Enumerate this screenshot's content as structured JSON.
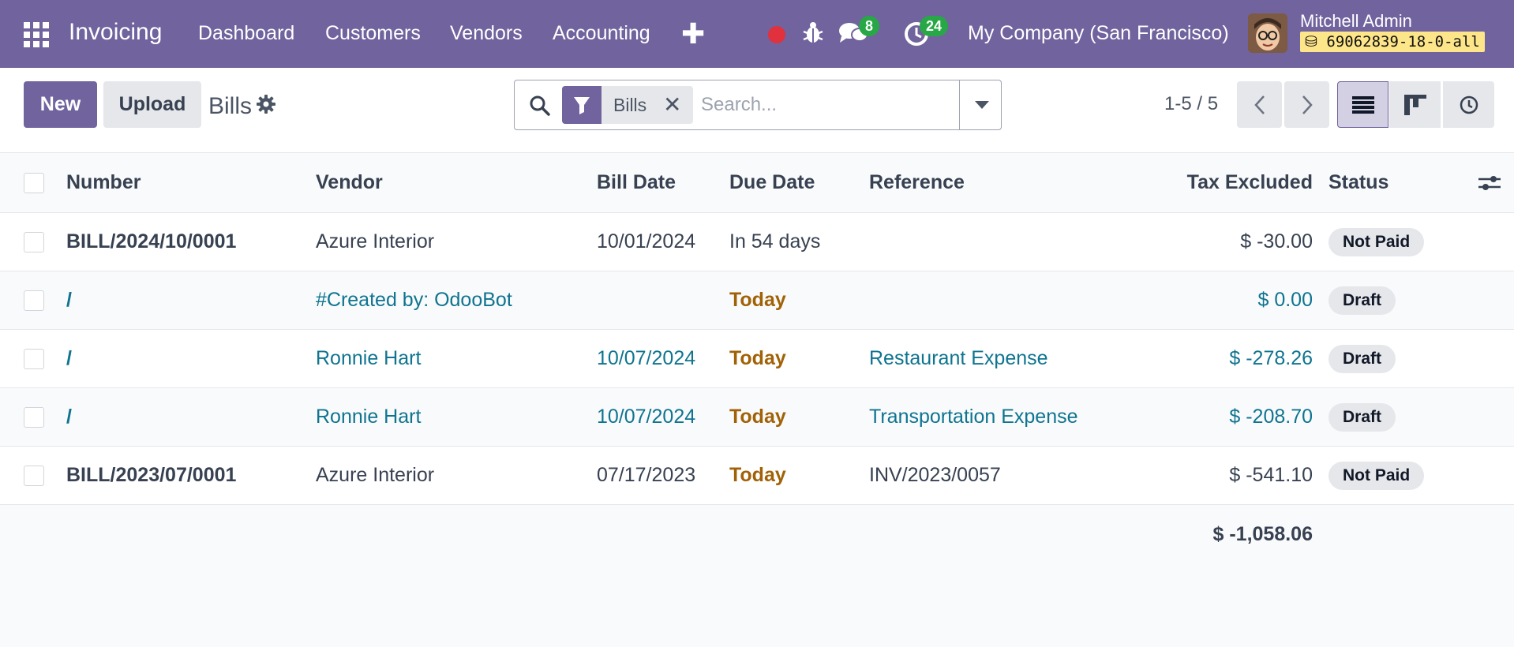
{
  "navbar": {
    "app_name": "Invoicing",
    "menu": [
      "Dashboard",
      "Customers",
      "Vendors",
      "Accounting"
    ],
    "messages_count": "8",
    "activities_count": "24",
    "company": "My Company (San Francisco)",
    "user_name": "Mitchell Admin",
    "database": "69062839-18-0-all",
    "accent_color": "#71639e"
  },
  "control": {
    "new_label": "New",
    "upload_label": "Upload",
    "breadcrumb": "Bills",
    "search": {
      "facet_label": "Bills",
      "placeholder": "Search..."
    },
    "pager": "1-5 / 5"
  },
  "table": {
    "columns": {
      "number": "Number",
      "vendor": "Vendor",
      "bill_date": "Bill Date",
      "due_date": "Due Date",
      "reference": "Reference",
      "tax_excluded": "Tax Excluded",
      "status": "Status"
    },
    "rows": [
      {
        "number": "BILL/2024/10/0001",
        "vendor": "Azure Interior",
        "bill_date": "10/01/2024",
        "due_date": "In 54 days",
        "reference": "",
        "tax_excluded": "$ -30.00",
        "status": "Not Paid"
      },
      {
        "number": "/",
        "vendor": "#Created by: OdooBot",
        "bill_date": "",
        "due_date": "Today",
        "reference": "",
        "tax_excluded": "$ 0.00",
        "status": "Draft"
      },
      {
        "number": "/",
        "vendor": "Ronnie Hart",
        "bill_date": "10/07/2024",
        "due_date": "Today",
        "reference": "Restaurant Expense",
        "tax_excluded": "$ -278.26",
        "status": "Draft"
      },
      {
        "number": "/",
        "vendor": "Ronnie Hart",
        "bill_date": "10/07/2024",
        "due_date": "Today",
        "reference": "Transportation Expense",
        "tax_excluded": "$ -208.70",
        "status": "Draft"
      },
      {
        "number": "BILL/2023/07/0001",
        "vendor": "Azure Interior",
        "bill_date": "07/17/2023",
        "due_date": "Today",
        "reference": "INV/2023/0057",
        "tax_excluded": "$ -541.10",
        "status": "Not Paid"
      }
    ],
    "total": "$ -1,058.06"
  }
}
